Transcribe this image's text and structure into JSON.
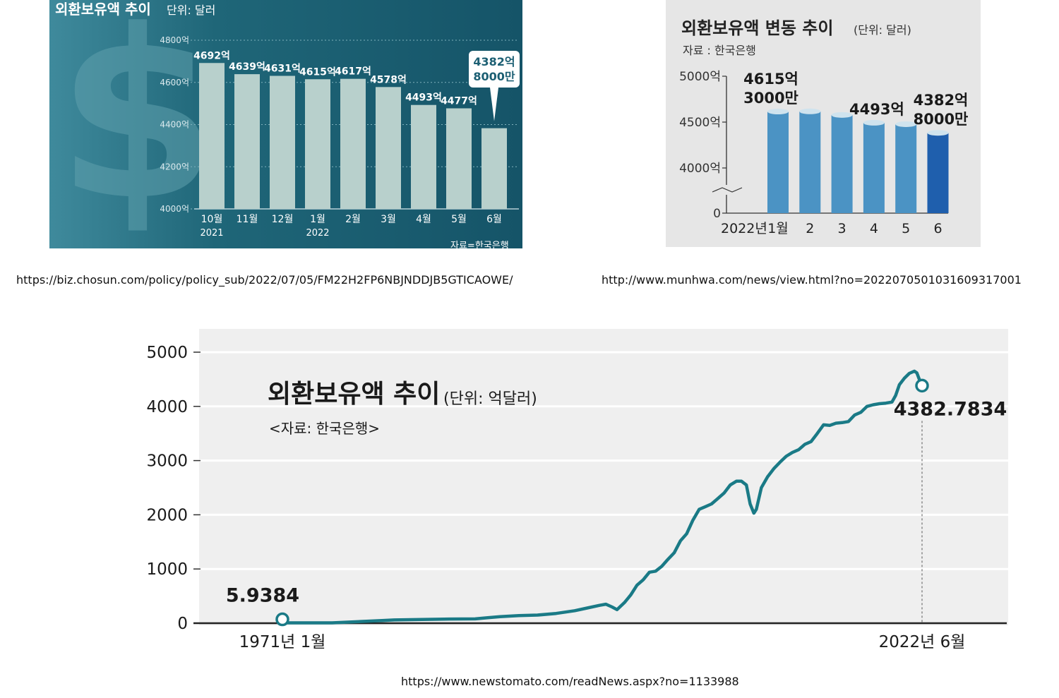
{
  "chart_data": [
    {
      "type": "bar",
      "title": "외환보유액 추이",
      "unit": "단위: 달러",
      "source": "자료=한국은행",
      "categories": [
        "10월",
        "11월",
        "12월",
        "1월",
        "2월",
        "3월",
        "4월",
        "5월",
        "6월"
      ],
      "year_labels": {
        "0": "2021",
        "3": "2022"
      },
      "values": [
        4692,
        4639,
        4631,
        4615,
        4617,
        4578,
        4493,
        4477,
        4382.8
      ],
      "value_labels": [
        "4692억",
        "4639억",
        "4631억",
        "4615억",
        "4617억",
        "4578억",
        "4493억",
        "4477억",
        ""
      ],
      "callout": [
        "4382억",
        "8000만"
      ],
      "y_ticks": [
        "4000억",
        "4200억",
        "4400억",
        "4600억",
        "4800억"
      ],
      "ylim": [
        4000,
        4800
      ],
      "colors": {
        "background": "#1c5f73",
        "bar": "#b8d0cc",
        "text": "#ffffff",
        "callout_text": "#1c5f73"
      }
    },
    {
      "type": "bar",
      "title": "외환보유액 변동 추이",
      "unit": "(단위: 달러)",
      "source": "자료 : 한국은행",
      "x_prefix": "2022년",
      "categories": [
        "1월",
        "2",
        "3",
        "4",
        "5",
        "6"
      ],
      "values": [
        4615.3,
        4617,
        4578,
        4493,
        4477,
        4382.8
      ],
      "value_labels": [
        [
          "4615억",
          "3000만"
        ],
        [],
        [],
        [
          "4493억"
        ],
        [],
        [
          "4382억",
          "8000만"
        ]
      ],
      "y_ticks": [
        "0",
        "4000억",
        "4500억",
        "5000억"
      ],
      "ylim": [
        3850,
        5000
      ],
      "colors": {
        "background": "#e6e6e6",
        "bar": "#4b93c4",
        "bar_highlight": "#1f5fad",
        "bar_top": "#cfe3ee"
      }
    },
    {
      "type": "line",
      "title": "외환보유액 추이",
      "unit": "(단위: 억달러)",
      "source": "<자료: 한국은행>",
      "x_labels": [
        "1971년 1월",
        "2022년 6월"
      ],
      "xlim": [
        1971.0,
        2022.42
      ],
      "y_ticks": [
        "0",
        "1000",
        "2000",
        "3000",
        "4000",
        "5000"
      ],
      "ylim": [
        0,
        5000
      ],
      "start_label": "5.9384",
      "end_label": "4382.7834",
      "series": [
        {
          "x": [
            1971.0,
            1975.0,
            1979.0,
            1980.0,
            1984.0,
            1986.5,
            1987.5,
            1988.5,
            1990.0,
            1991.5,
            1993.0,
            1994.5,
            1995.5,
            1996.5,
            1997.0,
            1997.5,
            1997.9,
            1998.5,
            1999.0,
            1999.5,
            2000.0,
            2000.5,
            2001.0,
            2001.5,
            2002.0,
            2002.5,
            2003.0,
            2003.5,
            2004.0,
            2004.5,
            2005.0,
            2005.5,
            2006.0,
            2006.5,
            2007.0,
            2007.5,
            2007.9,
            2008.3,
            2008.6,
            2008.9,
            2009.1,
            2009.5,
            2010.0,
            2010.5,
            2011.0,
            2011.5,
            2012.0,
            2012.5,
            2013.0,
            2013.5,
            2014.0,
            2014.5,
            2015.0,
            2015.5,
            2016.0,
            2016.5,
            2017.0,
            2017.5,
            2018.0,
            2018.5,
            2019.0,
            2019.5,
            2020.0,
            2020.3,
            2020.6,
            2021.0,
            2021.4,
            2021.8,
            2022.0,
            2022.2,
            2022.42
          ],
          "y": [
            5.9,
            6,
            50,
            60,
            75,
            80,
            100,
            120,
            140,
            150,
            180,
            230,
            280,
            330,
            350,
            300,
            250,
            380,
            520,
            700,
            800,
            940,
            960,
            1050,
            1180,
            1300,
            1520,
            1650,
            1900,
            2100,
            2150,
            2200,
            2300,
            2400,
            2550,
            2620,
            2620,
            2550,
            2200,
            2030,
            2100,
            2500,
            2700,
            2850,
            2970,
            3080,
            3150,
            3200,
            3300,
            3350,
            3500,
            3660,
            3650,
            3690,
            3700,
            3720,
            3840,
            3890,
            4000,
            4030,
            4050,
            4060,
            4080,
            4200,
            4400,
            4520,
            4610,
            4650,
            4620,
            4500,
            4382.8
          ]
        }
      ],
      "colors": {
        "line": "#1a7a86",
        "panel": "#efefef",
        "grid": "#ffffff"
      }
    }
  ],
  "sources": [
    "https://biz.chosun.com/policy/policy_sub/2022/07/05/FM22H2FP6NBJNDDJB5GTICAOWE/",
    "http://www.munhwa.com/news/view.html?no=2022070501031609317001",
    "https://www.newstomato.com/readNews.aspx?no=1133988"
  ]
}
